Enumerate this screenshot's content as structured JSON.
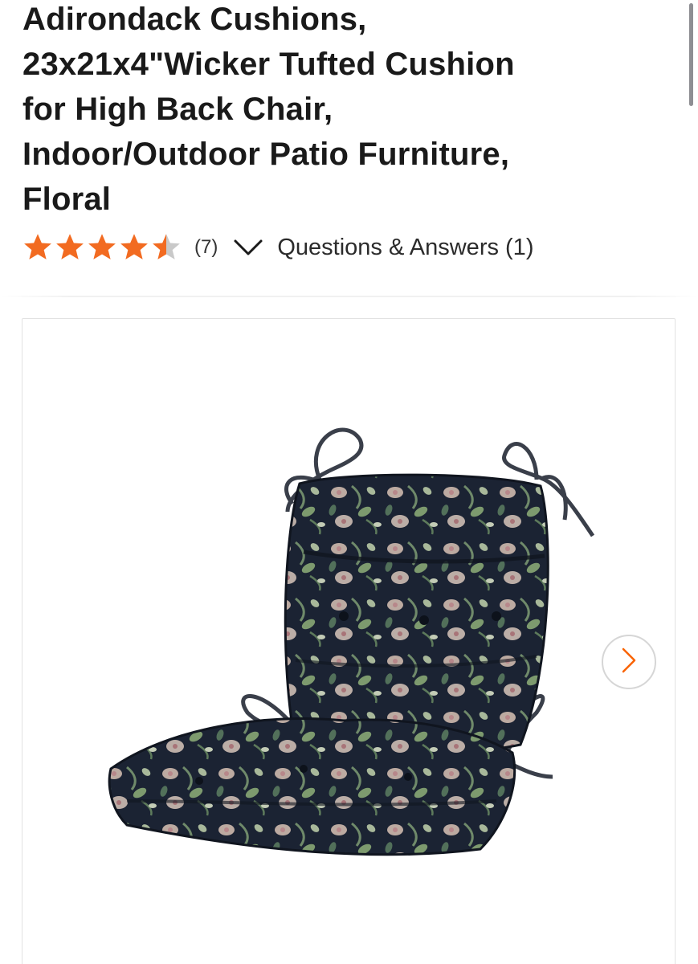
{
  "product": {
    "title_lines": [
      "Adirondack Cushions,",
      "23x21x4\"Wicker Tufted Cushion",
      "for High Back Chair,",
      "Indoor/Outdoor Patio Furniture,",
      "Floral"
    ],
    "rating": {
      "value": 4.5,
      "max": 5,
      "count_label": "(7)"
    },
    "qa_link": "Questions & Answers (1)"
  },
  "gallery": {
    "image_subject": "floral high back tufted chair cushion",
    "next_icon": "chevron-right-icon"
  },
  "colors": {
    "star": "#f26b21",
    "star_empty": "#c9c9c9",
    "accent": "#f96302"
  }
}
